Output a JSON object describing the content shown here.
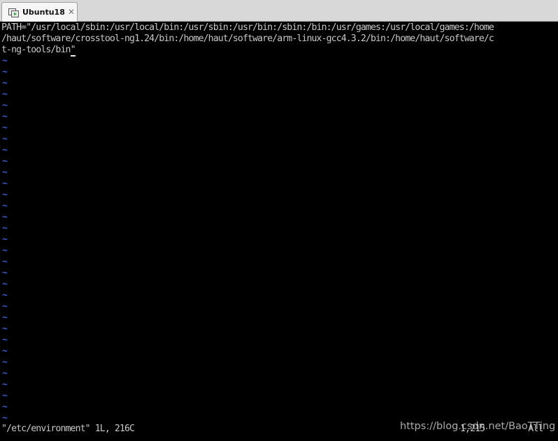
{
  "tab": {
    "title": "Ubuntu18",
    "close_glyph": "✕",
    "icon": "vm-icon"
  },
  "editor": {
    "lines": [
      "PATH=\"/usr/local/sbin:/usr/local/bin:/usr/sbin:/usr/bin:/sbin:/bin:/usr/games:/usr/local/games:/home",
      "/haut/software/crosstool-ng1.24/bin:/home/haut/software/arm-linux-gcc4.3.2/bin:/home/haut/software/c",
      "t-ng-tools/bin"
    ],
    "cursor_char": "\"",
    "tilde": "~",
    "status_line": "\"/etc/environment\" 1L, 216C",
    "ruler": "1,215",
    "scroll_position": "All"
  },
  "watermark": "https://blog.csdn.net/BaoTTing",
  "colors": {
    "terminal_bg": "#000000",
    "text": "#c8c8c8",
    "tilde": "#3a5bd8",
    "tabbar_bg": "#d8d8d8"
  }
}
